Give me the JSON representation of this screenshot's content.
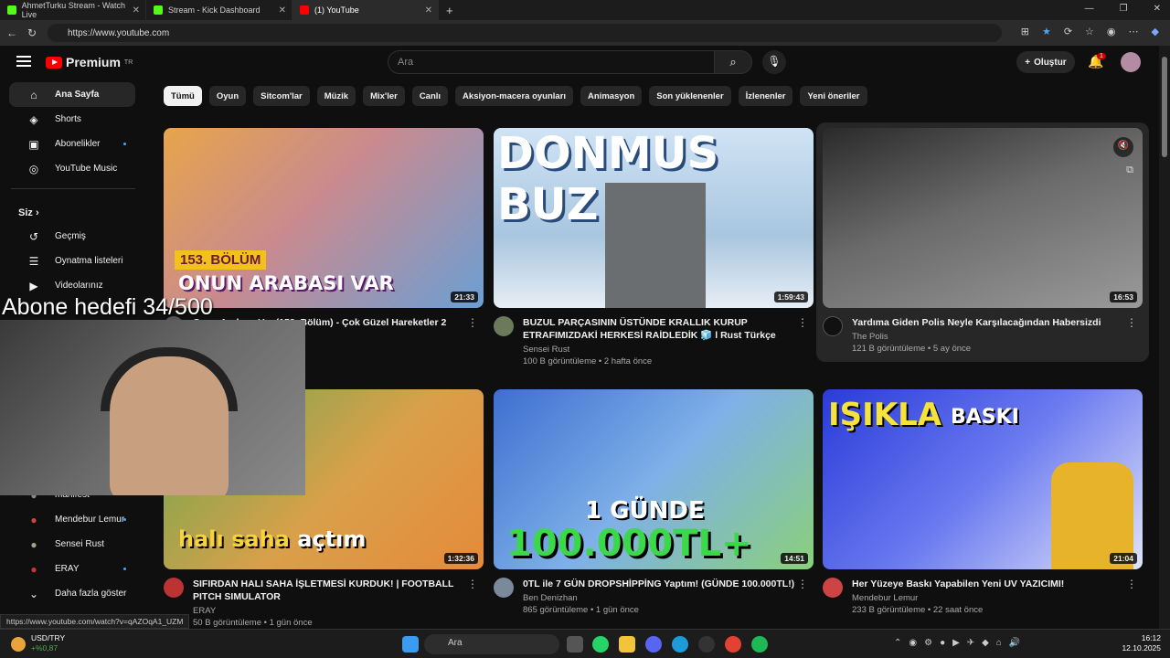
{
  "tabs": [
    {
      "label": "AhmetTurku Stream - Watch Live",
      "color": "#53fc18"
    },
    {
      "label": "Stream - Kick Dashboard",
      "color": "#53fc18"
    },
    {
      "label": "(1) YouTube",
      "color": "#ff0000"
    }
  ],
  "address": {
    "url": "https://www.youtube.com"
  },
  "header": {
    "logo_text": "Premium",
    "logo_sup": "TR",
    "search_placeholder": "Ara",
    "create_label": "Oluştur",
    "notif_count": "1"
  },
  "sidebar": {
    "items": [
      {
        "label": "Ana Sayfa",
        "icon": "home-icon"
      },
      {
        "label": "Shorts",
        "icon": "shorts-icon"
      },
      {
        "label": "Abonelikler",
        "icon": "subscriptions-icon"
      },
      {
        "label": "YouTube Music",
        "icon": "music-icon"
      }
    ],
    "you_section": "Siz",
    "you_items": [
      {
        "label": "Geçmiş"
      },
      {
        "label": "Oynatma listeleri"
      },
      {
        "label": "Videolarınız"
      }
    ],
    "subs": [
      {
        "label": "manifest"
      },
      {
        "label": "Mendebur Lemur"
      },
      {
        "label": "Sensei Rust"
      },
      {
        "label": "ERAY"
      }
    ],
    "more_label": "Daha fazla göster"
  },
  "chips": [
    "Tümü",
    "Oyun",
    "Sitcom'lar",
    "Müzik",
    "Mix'ler",
    "Canlı",
    "Aksiyon-macera oyunları",
    "Animasyon",
    "Son yüklenenler",
    "İzlenenler",
    "Yeni öneriler"
  ],
  "videos": [
    {
      "title": "Onun Arabası Var (153. Bölüm) - Çok Güzel Hareketler 2",
      "channel": "",
      "meta": "",
      "duration": "21:33",
      "thumb_text1": "153. BÖLÜM",
      "thumb_text2": "ONUN ARABASI VAR"
    },
    {
      "title": "BUZUL PARÇASININ ÜSTÜNDE KRALLIK KURUP ETRAFIMIZDAKİ HERKESİ RAİDLEDİK 🧊 l Rust Türkçe",
      "channel": "Sensei Rust",
      "meta": "100 B görüntüleme • 2 hafta önce",
      "duration": "1:59:43",
      "thumb_text1": "DONMUS BUZ"
    },
    {
      "title": "Yardıma Giden Polis Neyle Karşılacağından Habersizdi",
      "channel": "The Polis",
      "meta": "121 B görüntüleme • 5 ay önce",
      "duration": "16:53"
    },
    {
      "title": "SIFIRDAN HALI SAHA İŞLETMESİ KURDUK! | FOOTBALL PITCH SIMULATOR",
      "channel": "ERAY",
      "meta": "50 B görüntüleme • 1 gün önce",
      "duration": "1:32:36",
      "thumb_text1": "halı saha",
      "thumb_text2": "açtım"
    },
    {
      "title": "0TL ile 7 GÜN DROPSHİPPİNG Yaptım! (GÜNDE 100.000TL!)",
      "channel": "Ben Denizhan",
      "meta": "865 görüntüleme • 1 gün önce",
      "duration": "14:51",
      "thumb_text1": "1 GÜNDE",
      "thumb_text2": "100.000TL+"
    },
    {
      "title": "Her Yüzeye Baskı Yapabilen Yeni UV YAZICIMI!",
      "channel": "Mendebur Lemur",
      "meta": "233 B görüntüleme • 22 saat önce",
      "duration": "21:04",
      "thumb_text1": "IŞIKLA",
      "thumb_text2": "BASKI"
    }
  ],
  "overlay": {
    "goal_text": "Abone hedefi 34/500"
  },
  "status_url": "https://www.youtube.com/watch?v=qAZOqA1_UZM",
  "taskbar": {
    "search": "Ara",
    "ticker_name": "USD/TRY",
    "ticker_change": "+%0,87",
    "time": "16:12",
    "date": "12.10.2025"
  }
}
